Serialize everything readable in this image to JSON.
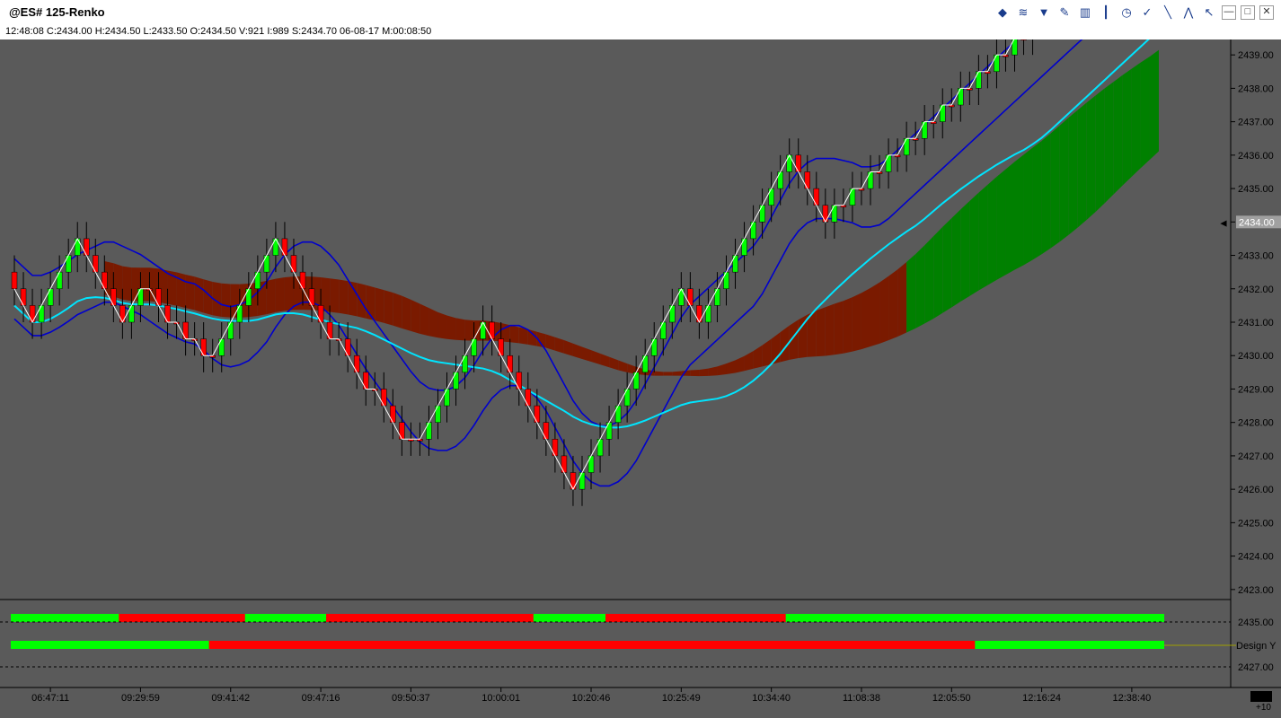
{
  "window": {
    "title": "@ES# 125-Renko",
    "info": "12:48:08  C:2434.00  H:2434.50  L:2433.50  O:2434.50  V:921  I:989  S:2434.70  06-08-17  M:00:08:50"
  },
  "toolbar": {
    "icons": [
      "data-icon",
      "waves-icon",
      "filter-icon",
      "pencil-icon",
      "bars-icon",
      "candle-icon",
      "clock-icon",
      "order-icon",
      "trendline-icon",
      "path-icon",
      "cursor-icon",
      "minimize-icon",
      "maximize-icon",
      "close-icon"
    ],
    "glyphs": [
      "◆",
      "≋",
      "▼",
      "✎",
      "▥",
      "┃",
      "◷",
      "✓",
      "╲",
      "⋀",
      "↖",
      "—",
      "□",
      "✕"
    ]
  },
  "colors": {
    "background": "#5a5a5a",
    "up": "#00ff00",
    "down": "#ff0000",
    "cloud_bear": "#7a1a00",
    "cloud_bull": "#008000",
    "band": "#0000cc",
    "slow_ma": "#00e5ff",
    "fast_ma": "#ffffff"
  },
  "chart_data": {
    "type": "candlestick",
    "title": "@ES# 125-Renko",
    "y_axis": {
      "ylim": [
        2422.7,
        2439.3
      ],
      "ticks": [
        "2439.00",
        "2438.00",
        "2437.00",
        "2436.00",
        "2435.00",
        "2434.00",
        "2433.00",
        "2432.00",
        "2431.00",
        "2430.00",
        "2429.00",
        "2428.00",
        "2427.00",
        "2426.00",
        "2425.00",
        "2424.00",
        "2423.00"
      ],
      "last_price_label": "2434.00",
      "last_price": 2434.0
    },
    "x_axis": {
      "labels": [
        "06:47:11",
        "09:29:59",
        "09:41:42",
        "09:47:16",
        "09:50:37",
        "10:00:01",
        "10:20:46",
        "10:25:49",
        "10:34:40",
        "11:08:38",
        "12:05:50",
        "12:16:24",
        "12:38:40"
      ],
      "label_bars": [
        4,
        14,
        24,
        34,
        44,
        54,
        64,
        74,
        84,
        94,
        104,
        114,
        124
      ]
    },
    "bar_count": 128,
    "closes": [
      2432.0,
      2431.5,
      2431.0,
      2431.5,
      2432.0,
      2432.5,
      2433.0,
      2433.5,
      2433.0,
      2432.5,
      2432.0,
      2431.5,
      2431.0,
      2431.5,
      2432.0,
      2432.0,
      2431.5,
      2431.0,
      2431.0,
      2430.5,
      2430.5,
      2430.0,
      2430.0,
      2430.5,
      2431.0,
      2431.5,
      2432.0,
      2432.5,
      2433.0,
      2433.5,
      2433.0,
      2432.5,
      2432.0,
      2431.5,
      2431.0,
      2430.5,
      2430.5,
      2430.0,
      2429.5,
      2429.0,
      2429.0,
      2428.5,
      2428.0,
      2427.5,
      2427.5,
      2427.5,
      2428.0,
      2428.5,
      2429.0,
      2429.5,
      2430.0,
      2430.5,
      2431.0,
      2430.5,
      2430.0,
      2429.5,
      2429.0,
      2428.5,
      2428.0,
      2427.5,
      2427.0,
      2426.5,
      2426.0,
      2426.5,
      2427.0,
      2427.5,
      2428.0,
      2428.5,
      2429.0,
      2429.5,
      2430.0,
      2430.5,
      2431.0,
      2431.5,
      2432.0,
      2431.5,
      2431.0,
      2431.5,
      2432.0,
      2432.5,
      2433.0,
      2433.5,
      2434.0,
      2434.5,
      2435.0,
      2435.5,
      2436.0,
      2435.5,
      2435.0,
      2434.5,
      2434.0
    ],
    "indicator_panels": [
      {
        "name": "panel-1",
        "ticks": [
          "2435.00"
        ],
        "segments": [
          {
            "from": 0,
            "to": 12,
            "color": "up"
          },
          {
            "from": 12,
            "to": 26,
            "color": "down"
          },
          {
            "from": 26,
            "to": 35,
            "color": "up"
          },
          {
            "from": 35,
            "to": 58,
            "color": "down"
          },
          {
            "from": 58,
            "to": 66,
            "color": "up"
          },
          {
            "from": 66,
            "to": 86,
            "color": "down"
          },
          {
            "from": 86,
            "to": 128,
            "color": "up"
          }
        ]
      },
      {
        "name": "panel-2",
        "ticks": [
          "2427.00"
        ],
        "right_label": "Design Y",
        "segments": [
          {
            "from": 0,
            "to": 22,
            "color": "up"
          },
          {
            "from": 22,
            "to": 107,
            "color": "down"
          },
          {
            "from": 107,
            "to": 128,
            "color": "up"
          }
        ]
      }
    ],
    "corner_label": "+10"
  }
}
